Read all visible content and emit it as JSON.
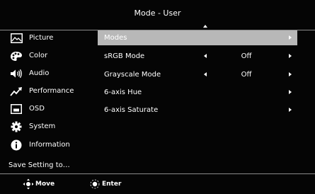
{
  "header": {
    "title": "Mode - User"
  },
  "sidebar": {
    "items": [
      {
        "label": "Picture",
        "icon": "picture-icon"
      },
      {
        "label": "Color",
        "icon": "palette-icon"
      },
      {
        "label": "Audio",
        "icon": "speaker-icon"
      },
      {
        "label": "Performance",
        "icon": "trend-arrow-icon"
      },
      {
        "label": "OSD",
        "icon": "osd-window-icon"
      },
      {
        "label": "System",
        "icon": "gear-icon"
      },
      {
        "label": "Information",
        "icon": "info-icon"
      }
    ],
    "save_label": "Save Setting to…"
  },
  "menu": {
    "rows": [
      {
        "label": "Modes",
        "value": "",
        "selected": true
      },
      {
        "label": "sRGB Mode",
        "value": "Off"
      },
      {
        "label": "Grayscale Mode",
        "value": "Off"
      },
      {
        "label": "6-axis Hue",
        "value": ""
      },
      {
        "label": "6-axis Saturate",
        "value": ""
      }
    ]
  },
  "footer": {
    "move_label": "Move",
    "enter_label": "Enter"
  },
  "colors": {
    "background": "#050505",
    "highlight": "#b8b8b8",
    "divider": "#8a8a8a",
    "text": "#ffffff"
  }
}
